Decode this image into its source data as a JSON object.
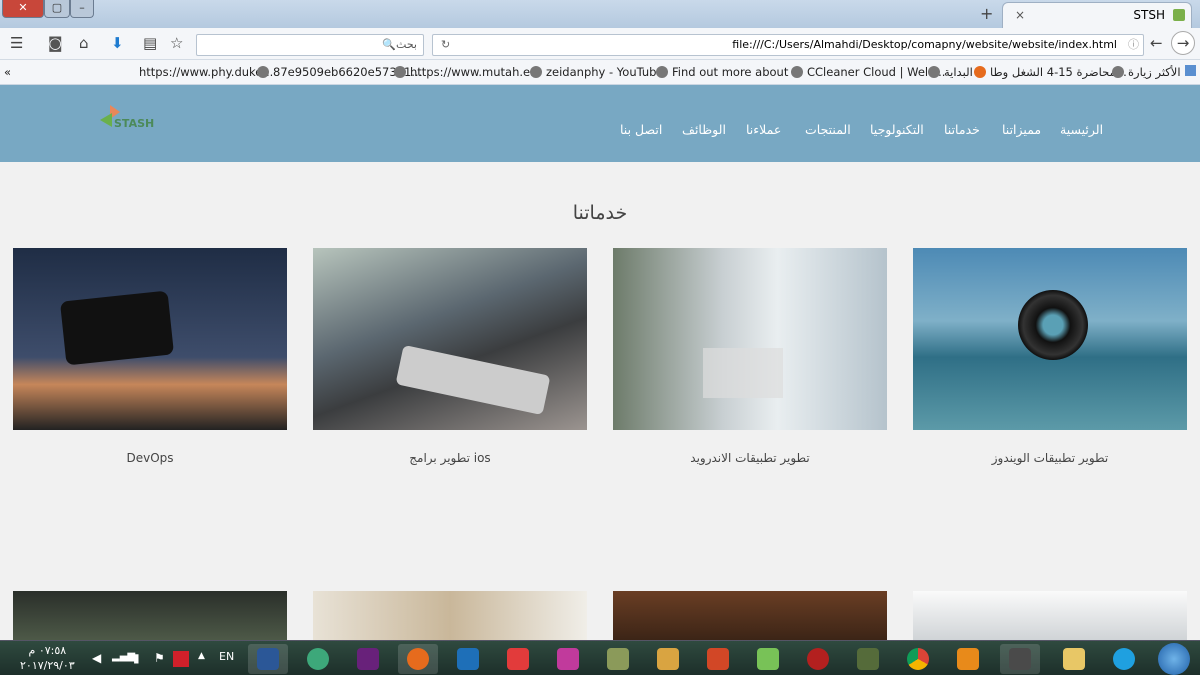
{
  "browser": {
    "tab_title": "STSH",
    "search_placeholder": "بحث",
    "url": "file:///C:/Users/Almahdi/Desktop/comapny/website/website/index.html",
    "bookmarks": [
      "https://www.phy.duke...",
      "87e9509eb6620e57351...",
      "https://www.mutah.e...",
      "zeidanphy - YouTube",
      "Find out more about ...",
      "CCleaner Cloud | Welc...",
      "البداية",
      "محاضرة 15-4 الشغل وطا...",
      "الأكثر زيارة"
    ]
  },
  "site": {
    "logo_text": "STASH",
    "nav": [
      "الرئيسية",
      "مميزاتنا",
      "خدماتنا",
      "التكنولوجيا",
      "المنتجات",
      "عملاءنا",
      "الوظائف",
      "اتصل بنا"
    ],
    "section_title": "خدماتنا",
    "services": [
      "تطوير تطبيقات الويندوز",
      "تطوير تطبيقات الاندرويد",
      "تطوير برامج ios",
      "DevOps"
    ]
  },
  "taskbar": {
    "time": "٠٧:٥٨ م",
    "date": "٢٠١٧/٢٩/٠٣",
    "lang": "EN"
  }
}
